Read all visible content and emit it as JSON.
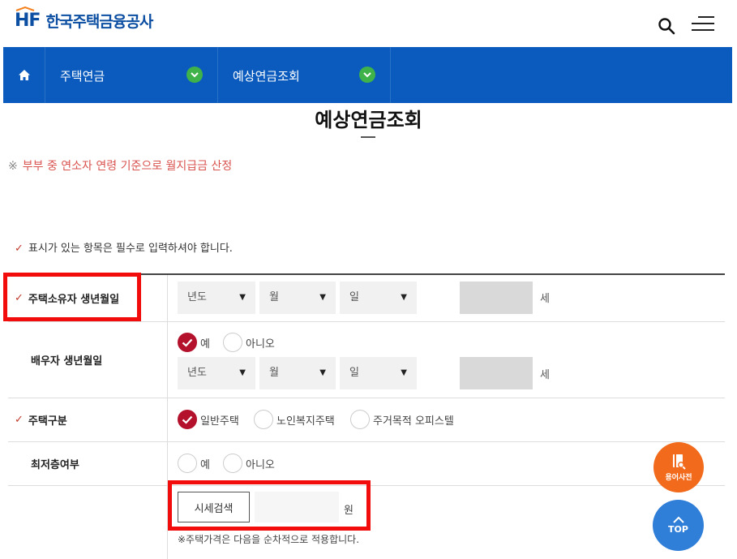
{
  "header": {
    "logo_mark": "HF",
    "logo_text": "한국주택금융공사"
  },
  "icons": {
    "search": "search-icon",
    "menu": "menu-icon",
    "home": "home-icon",
    "dropdown": "chevron-down-icon",
    "check": "check-icon",
    "book": "book-search-icon",
    "up": "arrow-up-icon"
  },
  "colors": {
    "brand": "#0b4ea2",
    "nav_bg": "#0a5bbd",
    "nav_chevron": "#3fb24a",
    "notice": "#d9534f",
    "radio_checked": "#b4122c",
    "highlight": "#f20c0c",
    "fab_dict": "#f26a1b",
    "fab_top": "#2f7ed8"
  },
  "nav": {
    "items": [
      {
        "label": "주택연금"
      },
      {
        "label": "예상연금조회"
      }
    ]
  },
  "page": {
    "title": "예상연금조회",
    "notice_mark": "※",
    "notice": "부부 중 연소자 연령 기준으로 월지급금 산정",
    "required_note": "표시가 있는 항목은 필수로 입력하셔야 합니다."
  },
  "form": {
    "owner_birth": {
      "label": "주택소유자 생년월일",
      "year": "년도",
      "month": "월",
      "day": "일",
      "age_unit": "세"
    },
    "spouse_birth": {
      "label": "배우자 생년월일",
      "yes": "예",
      "no": "아니오",
      "year": "년도",
      "month": "월",
      "day": "일",
      "age_unit": "세"
    },
    "house_type": {
      "label": "주택구분",
      "options": [
        "일반주택",
        "노인복지주택",
        "주거목적 오피스텔"
      ]
    },
    "lowest_floor": {
      "label": "최저층여부",
      "yes": "예",
      "no": "아니오"
    },
    "price": {
      "search_button": "시세검색",
      "input_value": "",
      "unit": "원",
      "note": "※주택가격은 다음을 순차적으로 적용합니다."
    }
  },
  "floating": {
    "dictionary": "용어사전",
    "top": "TOP"
  }
}
